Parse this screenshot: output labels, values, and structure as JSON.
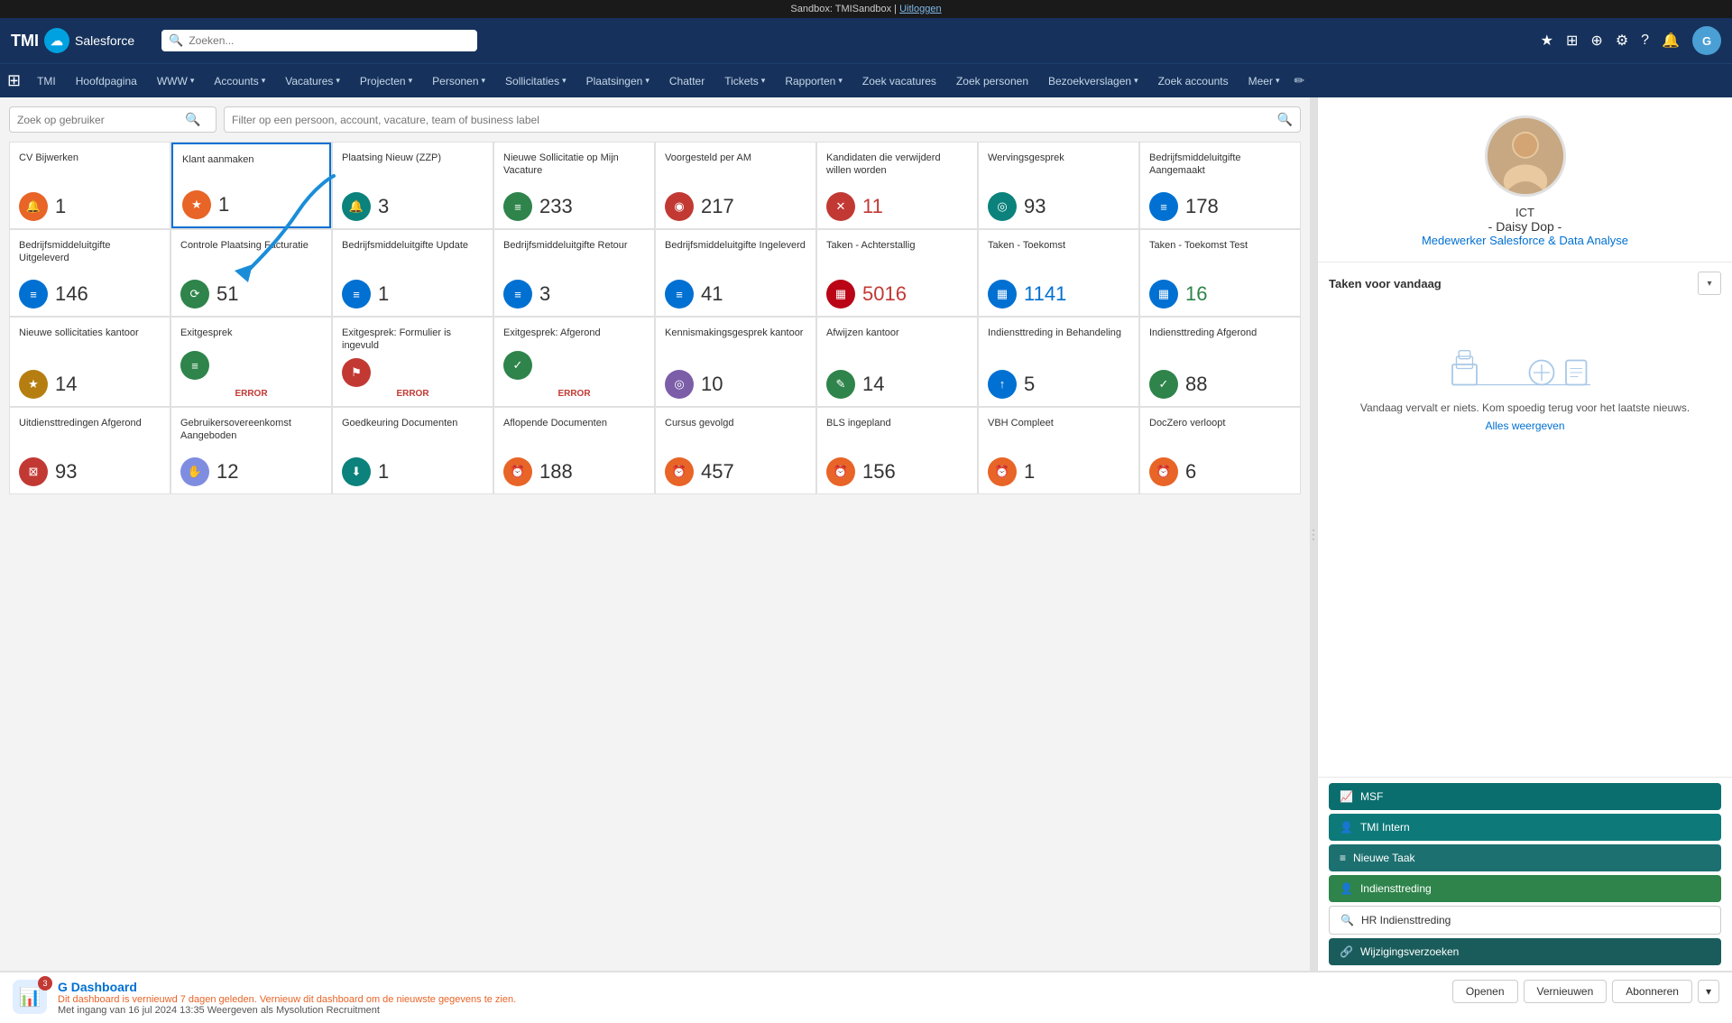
{
  "sandbox_bar": {
    "text": "Sandbox: TMISandbox |",
    "logout_text": "Uitloggen"
  },
  "header": {
    "logo_text": "TMI",
    "logo_sub": "Salesforce",
    "search_placeholder": "Zoeken...",
    "icons": [
      "★",
      "⊞",
      "⊕",
      "🔔",
      "?",
      "⚙",
      "🔔"
    ],
    "avatar_text": "G"
  },
  "navbar": {
    "grid_icon": "⊞",
    "app_label": "TMI",
    "items": [
      {
        "label": "Hoofdpagina",
        "has_chevron": false
      },
      {
        "label": "WWW",
        "has_chevron": true
      },
      {
        "label": "Accounts",
        "has_chevron": true
      },
      {
        "label": "Vacatures",
        "has_chevron": true
      },
      {
        "label": "Projecten",
        "has_chevron": true
      },
      {
        "label": "Personen",
        "has_chevron": true
      },
      {
        "label": "Sollicitaties",
        "has_chevron": true
      },
      {
        "label": "Plaatsingen",
        "has_chevron": true
      },
      {
        "label": "Chatter",
        "has_chevron": false
      },
      {
        "label": "Tickets",
        "has_chevron": true
      },
      {
        "label": "Rapporten",
        "has_chevron": true
      },
      {
        "label": "Zoek vacatures",
        "has_chevron": false
      },
      {
        "label": "Zoek personen",
        "has_chevron": false
      },
      {
        "label": "Bezoekverslagen",
        "has_chevron": true
      },
      {
        "label": "Zoek accounts",
        "has_chevron": false
      },
      {
        "label": "Meer",
        "has_chevron": true
      }
    ]
  },
  "filter_row": {
    "input1_placeholder": "Zoek op gebruiker",
    "input2_placeholder": "Filter op een persoon, account, vacature, team of business label"
  },
  "dashboard_cards": [
    {
      "title": "CV Bijwerken",
      "number": "1",
      "icon": "🔔",
      "icon_bg": "icon-orange-bg",
      "number_color": ""
    },
    {
      "title": "Klant aanmaken",
      "number": "1",
      "icon": "⭐",
      "icon_bg": "icon-orange-bg",
      "number_color": "",
      "highlighted": true
    },
    {
      "title": "Plaatsing Nieuw (ZZP)",
      "number": "3",
      "icon": "🔔",
      "icon_bg": "icon-teal-bg",
      "number_color": ""
    },
    {
      "title": "Nieuwe Sollicitatie op Mijn Vacature",
      "number": "233",
      "icon": "📋",
      "icon_bg": "icon-green-bg",
      "number_color": ""
    },
    {
      "title": "Voorgesteld per AM",
      "number": "217",
      "icon": "👤",
      "icon_bg": "icon-red-bg",
      "number_color": ""
    },
    {
      "title": "Kandidaten die verwijderd willen worden",
      "number": "11",
      "icon": "✕",
      "icon_bg": "icon-red-bg",
      "number_color": "red"
    },
    {
      "title": "Wervingsgesprek",
      "number": "93",
      "icon": "👥",
      "icon_bg": "icon-teal-bg",
      "number_color": ""
    },
    {
      "title": "Bedrijfsmiddeluitgifte Aangemaakt",
      "number": "178",
      "icon": "📋",
      "icon_bg": "icon-blue-bg",
      "number_color": ""
    },
    {
      "title": "Bedrijfsmiddeluitgifte Uitgeleverd",
      "number": "146",
      "icon": "📋",
      "icon_bg": "icon-blue-bg",
      "number_color": ""
    },
    {
      "title": "Controle Plaatsing Facturatie",
      "number": "51",
      "icon": "🔄",
      "icon_bg": "icon-green-bg",
      "number_color": ""
    },
    {
      "title": "Bedrijfsmiddeluitgifte Update",
      "number": "1",
      "icon": "📋",
      "icon_bg": "icon-blue-bg",
      "number_color": ""
    },
    {
      "title": "Bedrijfsmiddeluitgifte Retour",
      "number": "3",
      "icon": "📋",
      "icon_bg": "icon-blue-bg",
      "number_color": ""
    },
    {
      "title": "Bedrijfsmiddeluitgifte Ingeleverd",
      "number": "41",
      "icon": "📋",
      "icon_bg": "icon-blue-bg",
      "number_color": ""
    },
    {
      "title": "Taken - Achterstallig",
      "number": "5016",
      "icon": "📅",
      "icon_bg": "icon-pink-bg",
      "number_color": "red"
    },
    {
      "title": "Taken - Toekomst",
      "number": "1141",
      "icon": "📅",
      "icon_bg": "icon-blue-bg",
      "number_color": "blue"
    },
    {
      "title": "Taken - Toekomst Test",
      "number": "16",
      "icon": "📅",
      "icon_bg": "icon-blue-bg",
      "number_color": "green"
    },
    {
      "title": "Nieuwe sollicitaties kantoor",
      "number": "14",
      "icon": "⭐",
      "icon_bg": "icon-gold-bg",
      "number_color": ""
    },
    {
      "title": "Exitgesprek",
      "number": "",
      "icon": "📋",
      "icon_bg": "icon-green-bg",
      "number_color": "",
      "error": "ERROR"
    },
    {
      "title": "Exitgesprek: Formulier is ingevuld",
      "number": "",
      "icon": "🚩",
      "icon_bg": "icon-red-bg",
      "number_color": "",
      "error": "ERROR"
    },
    {
      "title": "Exitgesprek: Afgerond",
      "number": "",
      "icon": "✔",
      "icon_bg": "icon-green-bg",
      "number_color": "",
      "error": "ERROR"
    },
    {
      "title": "Kennismakingsgesprek kantoor",
      "number": "10",
      "icon": "👥",
      "icon_bg": "icon-purple-bg",
      "number_color": ""
    },
    {
      "title": "Afwijzen kantoor",
      "number": "14",
      "icon": "✏",
      "icon_bg": "icon-green-bg",
      "number_color": ""
    },
    {
      "title": "Indiensttreding in Behandeling",
      "number": "5",
      "icon": "↑",
      "icon_bg": "icon-blue-bg",
      "number_color": ""
    },
    {
      "title": "Indiensttreding Afgerond",
      "number": "88",
      "icon": "✔",
      "icon_bg": "icon-green-bg",
      "number_color": ""
    },
    {
      "title": "Uitdiensttredingen Afgerond",
      "number": "93",
      "icon": "🗑",
      "icon_bg": "icon-red-bg",
      "number_color": ""
    },
    {
      "title": "Gebruikersovereenkomst Aangeboden",
      "number": "12",
      "icon": "✋",
      "icon_bg": "icon-gray-bg",
      "number_color": ""
    },
    {
      "title": "Goedkeuring Documenten",
      "number": "1",
      "icon": "⬇",
      "icon_bg": "icon-teal-bg",
      "number_color": ""
    },
    {
      "title": "Aflopende Documenten",
      "number": "188",
      "icon": "⏰",
      "icon_bg": "icon-orange-bg",
      "number_color": ""
    },
    {
      "title": "Cursus gevolgd",
      "number": "457",
      "icon": "⏰",
      "icon_bg": "icon-orange-bg",
      "number_color": ""
    },
    {
      "title": "BLS ingepland",
      "number": "156",
      "icon": "⏰",
      "icon_bg": "icon-orange-bg",
      "number_color": ""
    },
    {
      "title": "VBH Compleet",
      "number": "1",
      "icon": "⏰",
      "icon_bg": "icon-orange-bg",
      "number_color": ""
    },
    {
      "title": "DocZero verloopt",
      "number": "6",
      "icon": "⏰",
      "icon_bg": "icon-orange-bg",
      "number_color": ""
    }
  ],
  "right_panel": {
    "dept": "ICT",
    "name": "- Daisy Dop -",
    "role": "Medewerker Salesforce & Data Analyse",
    "taken_title": "Taken voor vandaag",
    "taken_empty_text": "Vandaag vervalt er niets. Kom spoedig terug voor het laatste nieuws.",
    "taken_link": "Alles weergeven",
    "buttons": [
      {
        "label": "MSF",
        "icon": "📈",
        "style": "teal"
      },
      {
        "label": "TMI Intern",
        "icon": "👤",
        "style": "teal-light"
      },
      {
        "label": "Nieuwe Taak",
        "icon": "≡",
        "style": "teal2"
      },
      {
        "label": "Indiensttreding",
        "icon": "👤",
        "style": "green"
      },
      {
        "label": "HR Indiensttreding",
        "icon": "🔍",
        "style": "outline"
      },
      {
        "label": "Wijzigingsverzoeken",
        "icon": "🔗",
        "style": "dark-teal"
      }
    ]
  },
  "bottom_bar": {
    "badge_count": "3",
    "title": "G Dashboard",
    "warning": "Dit dashboard is vernieuwd 7 dagen geleden. Vernieuw dit dashboard om de nieuwste gegevens te zien.",
    "meta": "Met ingang van 16 jul 2024 13:35 Weergeven als Mysolution Recruitment",
    "btn_open": "Openen",
    "btn_refresh": "Vernieuwen",
    "btn_subscribe": "Abonneren"
  }
}
